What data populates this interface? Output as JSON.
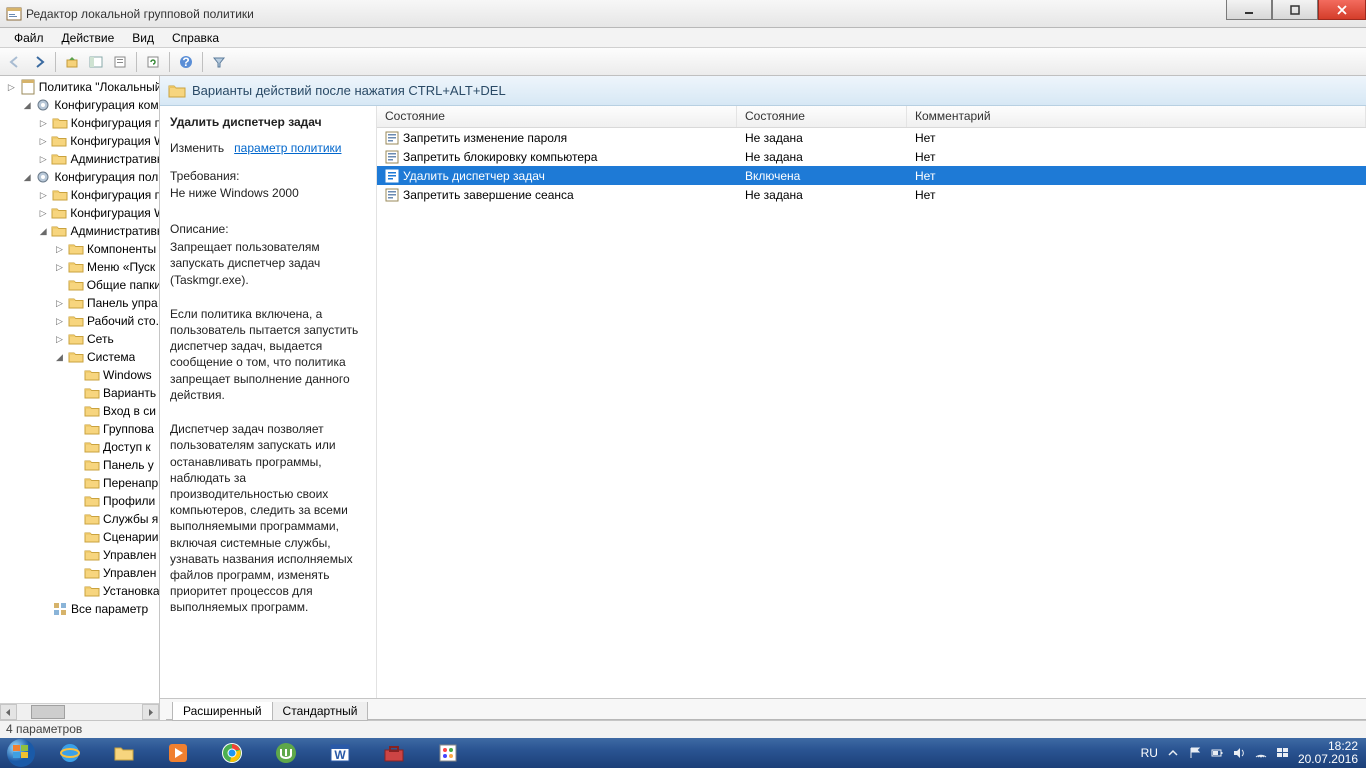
{
  "window": {
    "title": "Редактор локальной групповой политики"
  },
  "menu": {
    "file": "Файл",
    "action": "Действие",
    "view": "Вид",
    "help": "Справка"
  },
  "tree": {
    "root": "Политика \"Локальный",
    "comp_cfg": "Конфигурация комп",
    "comp_soft": "Конфигурация п",
    "comp_win": "Конфигурация W",
    "comp_admin": "Административн",
    "user_cfg": "Конфигурация поль",
    "user_soft": "Конфигурация п",
    "user_win": "Конфигурация W",
    "user_admin": "Административн",
    "components": "Компоненты",
    "startmenu": "Меню «Пуск",
    "shared_folders": "Общие папки",
    "control_panel": "Панель упра",
    "desktop": "Рабочий сто.",
    "network": "Сеть",
    "system": "Система",
    "sys_windows": "Windows",
    "sys_variants": "Варианть",
    "sys_login": "Вход в си",
    "sys_group": "Группова",
    "sys_access": "Доступ к",
    "sys_panel": "Панель у",
    "sys_redirect": "Перенапр",
    "sys_profiles": "Профили",
    "sys_services": "Службы я",
    "sys_scripts": "Сценарии",
    "sys_mgmt1": "Управлен",
    "sys_mgmt2": "Управлен",
    "sys_install": "Установка",
    "all_params": "Все параметр"
  },
  "detail": {
    "header": "Варианты действий после нажатия CTRL+ALT+DEL",
    "policy_name": "Удалить диспетчер задач",
    "edit_label": "Изменить",
    "edit_link": "параметр политики",
    "req_label": "Требования:",
    "req_text": "Не ниже Windows 2000",
    "desc_label": "Описание:",
    "desc_p1": "Запрещает пользователям запускать диспетчер задач (Taskmgr.exe).",
    "desc_p2": "Если политика включена, а пользователь пытается запустить диспетчер задач, выдается сообщение о том, что политика запрещает выполнение данного действия.",
    "desc_p3": "Диспетчер задач позволяет пользователям запускать или останавливать программы, наблюдать за производительностью своих компьютеров, следить за всеми выполняемыми программами, включая системные службы, узнавать названия исполняемых файлов программ, изменять приоритет процессов для выполняемых программ."
  },
  "columns": {
    "state1": "Состояние",
    "state2": "Состояние",
    "comment": "Комментарий"
  },
  "rows": [
    {
      "name": "Запретить изменение пароля",
      "state": "Не задана",
      "comment": "Нет",
      "selected": false
    },
    {
      "name": "Запретить блокировку компьютера",
      "state": "Не задана",
      "comment": "Нет",
      "selected": false
    },
    {
      "name": "Удалить диспетчер задач",
      "state": "Включена",
      "comment": "Нет",
      "selected": true
    },
    {
      "name": "Запретить завершение сеанса",
      "state": "Не задана",
      "comment": "Нет",
      "selected": false
    }
  ],
  "tabs": {
    "extended": "Расширенный",
    "standard": "Стандартный"
  },
  "statusbar": "4 параметров",
  "tray": {
    "lang": "RU",
    "time": "18:22",
    "date": "20.07.2016"
  }
}
